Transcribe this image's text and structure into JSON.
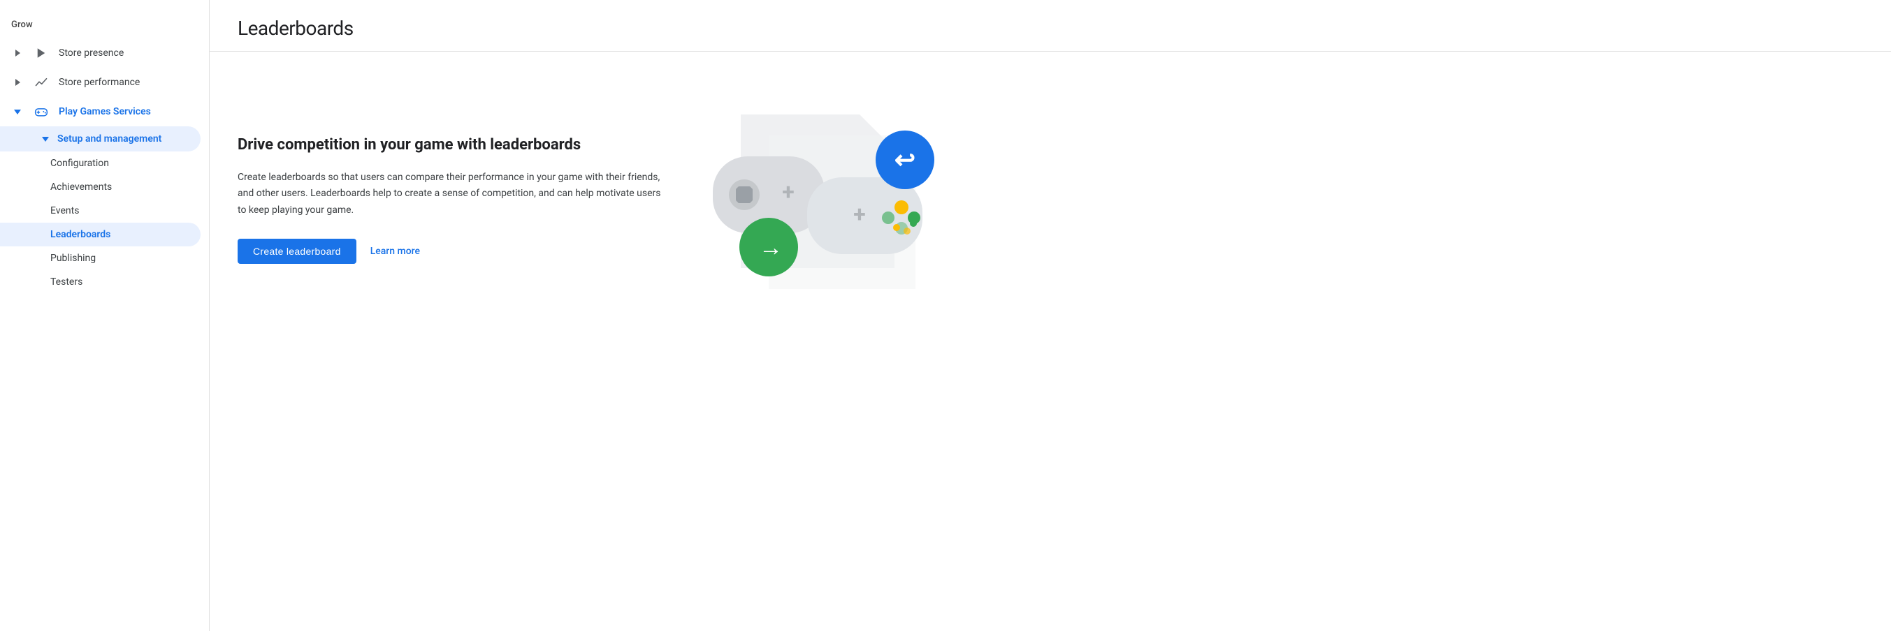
{
  "sidebar": {
    "section_label": "Grow",
    "items": [
      {
        "id": "store-presence",
        "label": "Store presence",
        "icon": "play-triangle-icon",
        "expanded": false,
        "active": false
      },
      {
        "id": "store-performance",
        "label": "Store performance",
        "icon": "trend-icon",
        "expanded": false,
        "active": false
      },
      {
        "id": "play-games-services",
        "label": "Play Games Services",
        "icon": "gamepad-icon",
        "expanded": true,
        "active": true,
        "sub_items": [
          {
            "id": "setup-management",
            "label": "Setup and management",
            "expanded": true,
            "active": true,
            "sub_sub_items": [
              {
                "id": "configuration",
                "label": "Configuration",
                "active": false
              },
              {
                "id": "achievements",
                "label": "Achievements",
                "active": false
              },
              {
                "id": "events",
                "label": "Events",
                "active": false
              },
              {
                "id": "leaderboards",
                "label": "Leaderboards",
                "active": true
              },
              {
                "id": "publishing",
                "label": "Publishing",
                "active": false
              },
              {
                "id": "testers",
                "label": "Testers",
                "active": false
              }
            ]
          }
        ]
      }
    ]
  },
  "page": {
    "title": "Leaderboards",
    "heading": "Drive competition in your game with leaderboards",
    "description": "Create leaderboards so that users can compare their performance in your game with their friends, and other users. Leaderboards help to create a sense of competition, and can help motivate users to keep playing your game.",
    "create_button": "Create leaderboard",
    "learn_more": "Learn more"
  },
  "colors": {
    "blue": "#1a73e8",
    "green": "#34a853",
    "yellow": "#fbbc04",
    "gray_controller": "#9aa0a6",
    "light_gray": "#dadce0",
    "bg_shape": "#e8eaed"
  }
}
